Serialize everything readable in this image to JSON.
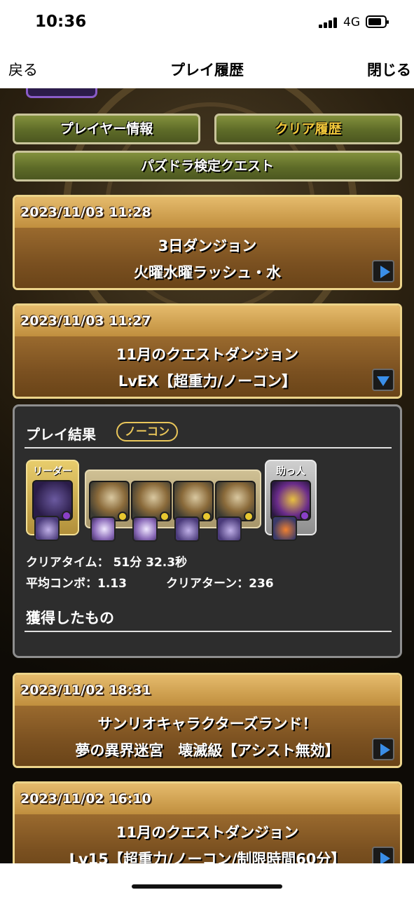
{
  "status_bar": {
    "time": "10:36",
    "network": "4G"
  },
  "nav": {
    "back_label": "戻る",
    "title": "プレイ履歴",
    "close_label": "閉じる"
  },
  "tabs": {
    "player_info": "プレイヤー情報",
    "clear_history": "クリア履歴",
    "exam_quest": "パズドラ検定クエスト"
  },
  "entries": [
    {
      "datetime": "2023/11/03 11:28",
      "title": "3日ダンジョン",
      "subtitle": "火曜水曜ラッシュ・水"
    },
    {
      "datetime": "2023/11/03 11:27",
      "title": "11月のクエストダンジョン",
      "subtitle": "LvEX【超重力/ノーコン】"
    },
    {
      "datetime": "2023/11/02 18:31",
      "title": "サンリオキャラクターズランド！",
      "subtitle": "夢の異界迷宮　壊滅級【アシスト無効】"
    },
    {
      "datetime": "2023/11/02 16:10",
      "title": "11月のクエストダンジョン",
      "subtitle": "Lv15【超重力/ノーコン/制限時間60分】"
    }
  ],
  "result": {
    "title": "プレイ結果",
    "badge": "ノーコン",
    "leader_label": "リーダー",
    "helper_label": "助っ人",
    "clear_time": "クリアタイム： 51分 32.3秒",
    "avg_combo": "平均コンボ：1.13",
    "clear_turns": "クリアターン：236",
    "obtained_heading": "獲得したもの"
  },
  "colors": {
    "gold_text": "#f2c83a",
    "button_green": "#5e6b28",
    "entry_brown": "#7a5020",
    "arrow_blue": "#3a8ee8"
  }
}
